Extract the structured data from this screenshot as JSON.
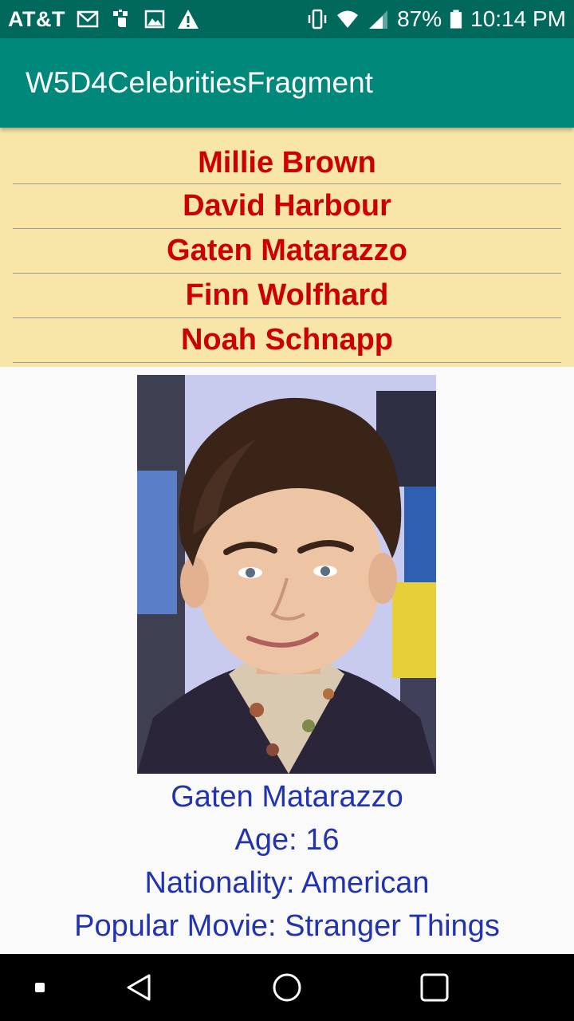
{
  "status_bar": {
    "carrier": "AT&T",
    "battery": "87%",
    "time": "10:14 PM",
    "icons_left": [
      "gmail-icon",
      "usb-debug-icon",
      "image-icon",
      "warning-icon"
    ],
    "icons_right": [
      "vibrate-icon",
      "wifi-icon",
      "signal-icon",
      "battery-icon"
    ]
  },
  "app_bar": {
    "title": "W5D4CelebritiesFragment"
  },
  "celebrities": [
    {
      "name": "Millie Brown"
    },
    {
      "name": "David Harbour"
    },
    {
      "name": "Gaten Matarazzo"
    },
    {
      "name": "Finn Wolfhard"
    },
    {
      "name": "Noah Schnapp"
    }
  ],
  "detail": {
    "name": "Gaten Matarazzo",
    "age": "Age: 16",
    "nationality": "Nationality: American",
    "popular_movie": "Popular Movie: Stranger Things"
  },
  "nav_bar": {
    "buttons": [
      "recents-dot-icon",
      "back-icon",
      "home-icon",
      "overview-icon"
    ]
  },
  "colors": {
    "status_bar": "#00695c",
    "app_bar": "#00897b",
    "list_background": "#f7e6a8",
    "list_text": "#cc0000",
    "detail_text": "#2133b0"
  }
}
